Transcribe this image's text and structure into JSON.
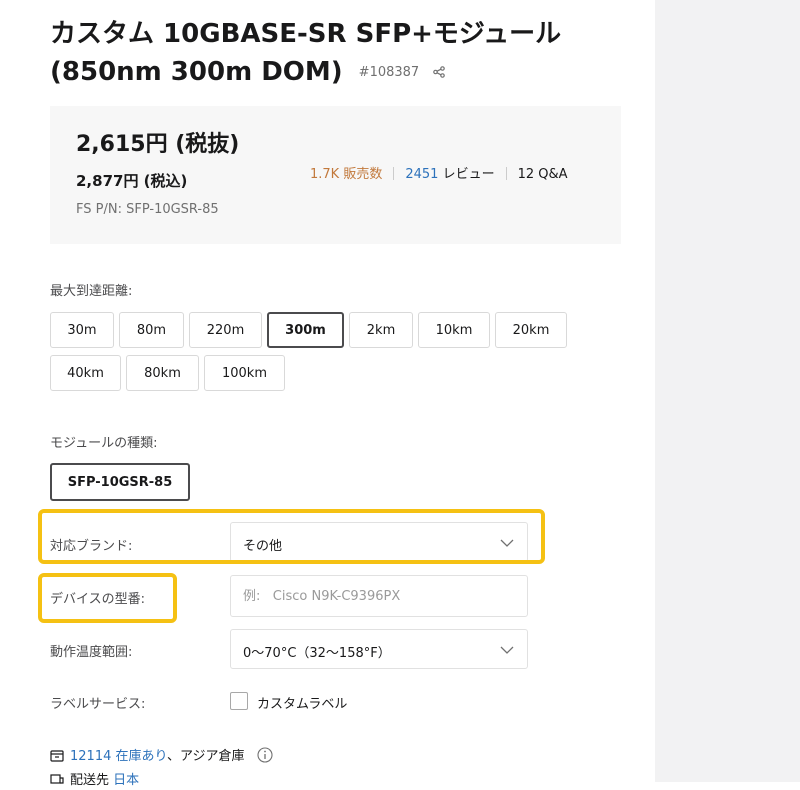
{
  "product": {
    "title_line1": "カスタム 10GBASE-SR SFP+モジュール",
    "title_line2": "(850nm 300m DOM)",
    "sku": "#108387"
  },
  "price": {
    "excl_tax": "2,615円 (税抜)",
    "incl_tax": "2,877円 (税込)",
    "part_number": "FS P/N: SFP-10GSR-85",
    "sold": "1.7K 販売数",
    "reviews_count": "2451",
    "reviews_label": "レビュー",
    "qa": "12 Q&A"
  },
  "distance": {
    "label": "最大到達距離:",
    "options": [
      "30m",
      "80m",
      "220m",
      "300m",
      "2km",
      "10km",
      "20km",
      "40km",
      "80km",
      "100km"
    ],
    "selected": "300m"
  },
  "module_type": {
    "label": "モジュールの種類:",
    "options": [
      "SFP-10GSR-85"
    ],
    "selected": "SFP-10GSR-85"
  },
  "brand": {
    "label": "対応ブランド:",
    "value": "その他"
  },
  "device_model": {
    "label": "デバイスの型番:",
    "placeholder": "例:   Cisco N9K-C9396PX"
  },
  "temperature": {
    "label": "動作温度範囲:",
    "value": "0～70°C（32～158°F）"
  },
  "label_service": {
    "label": "ラベルサービス:",
    "option": "カスタムラベル"
  },
  "stock": {
    "count": "12114",
    "status": "在庫あり",
    "location": "、アジア倉庫"
  },
  "shipping": {
    "label": "配送先",
    "country": "日本"
  },
  "colors": {
    "highlight": "#f5c113",
    "link": "#2d72bb",
    "sold": "#c2793c"
  }
}
